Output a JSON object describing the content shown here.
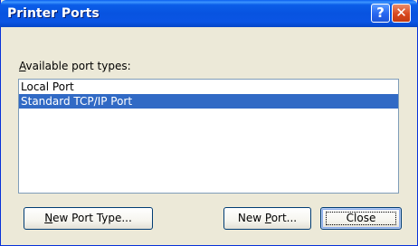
{
  "window": {
    "title": "Printer Ports"
  },
  "title_buttons": {
    "help_glyph": "?",
    "close_glyph": "✕"
  },
  "port_types": {
    "label_accel": "A",
    "label_rest": "vailable port types:",
    "items": [
      {
        "label": "Local Port",
        "selected": false
      },
      {
        "label": "Standard TCP/IP Port",
        "selected": true
      }
    ]
  },
  "buttons": {
    "new_port_type": {
      "accel": "N",
      "rest": "ew Port Type..."
    },
    "new_port": {
      "pre": "New ",
      "accel": "P",
      "rest": "ort..."
    },
    "close": "Close"
  },
  "colors": {
    "title_bar": "#0853e0",
    "dialog_face": "#ece9d8",
    "selection": "#316ac5",
    "close_button_red": "#d9481f"
  }
}
